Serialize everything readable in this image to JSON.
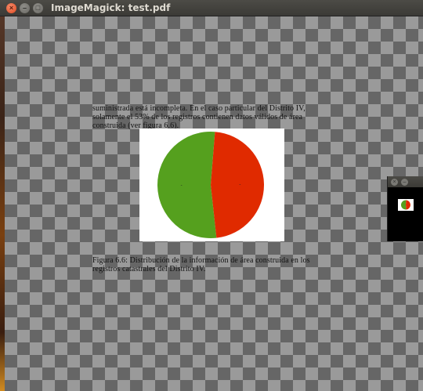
{
  "window": {
    "title": "ImageMagick: test.pdf",
    "close_symbol": "×",
    "minimize_symbol": "–",
    "maximize_symbol": "□"
  },
  "document": {
    "paragraph": "suministrada está incompleta. En el caso particular del Distrito IV, solamente el 53% de los registros contienen datos válidos de área construida (ver figura 6.6).",
    "caption": "Figura 6.6: Distribución de la información de área construida en los registros catastrales del Distrito IV."
  },
  "chart_data": {
    "type": "pie",
    "slices": [
      {
        "label": "-",
        "value": 53,
        "color": "#55a01e"
      },
      {
        "label": "-",
        "value": 47,
        "color": "#e02a00"
      }
    ]
  },
  "mini_window": {
    "close_symbol": "×",
    "other_symbol": "–"
  },
  "colors": {
    "green": "#55a01e",
    "red": "#e02a00",
    "checker_dark": "#666666",
    "checker_light": "#9a9a9a"
  }
}
